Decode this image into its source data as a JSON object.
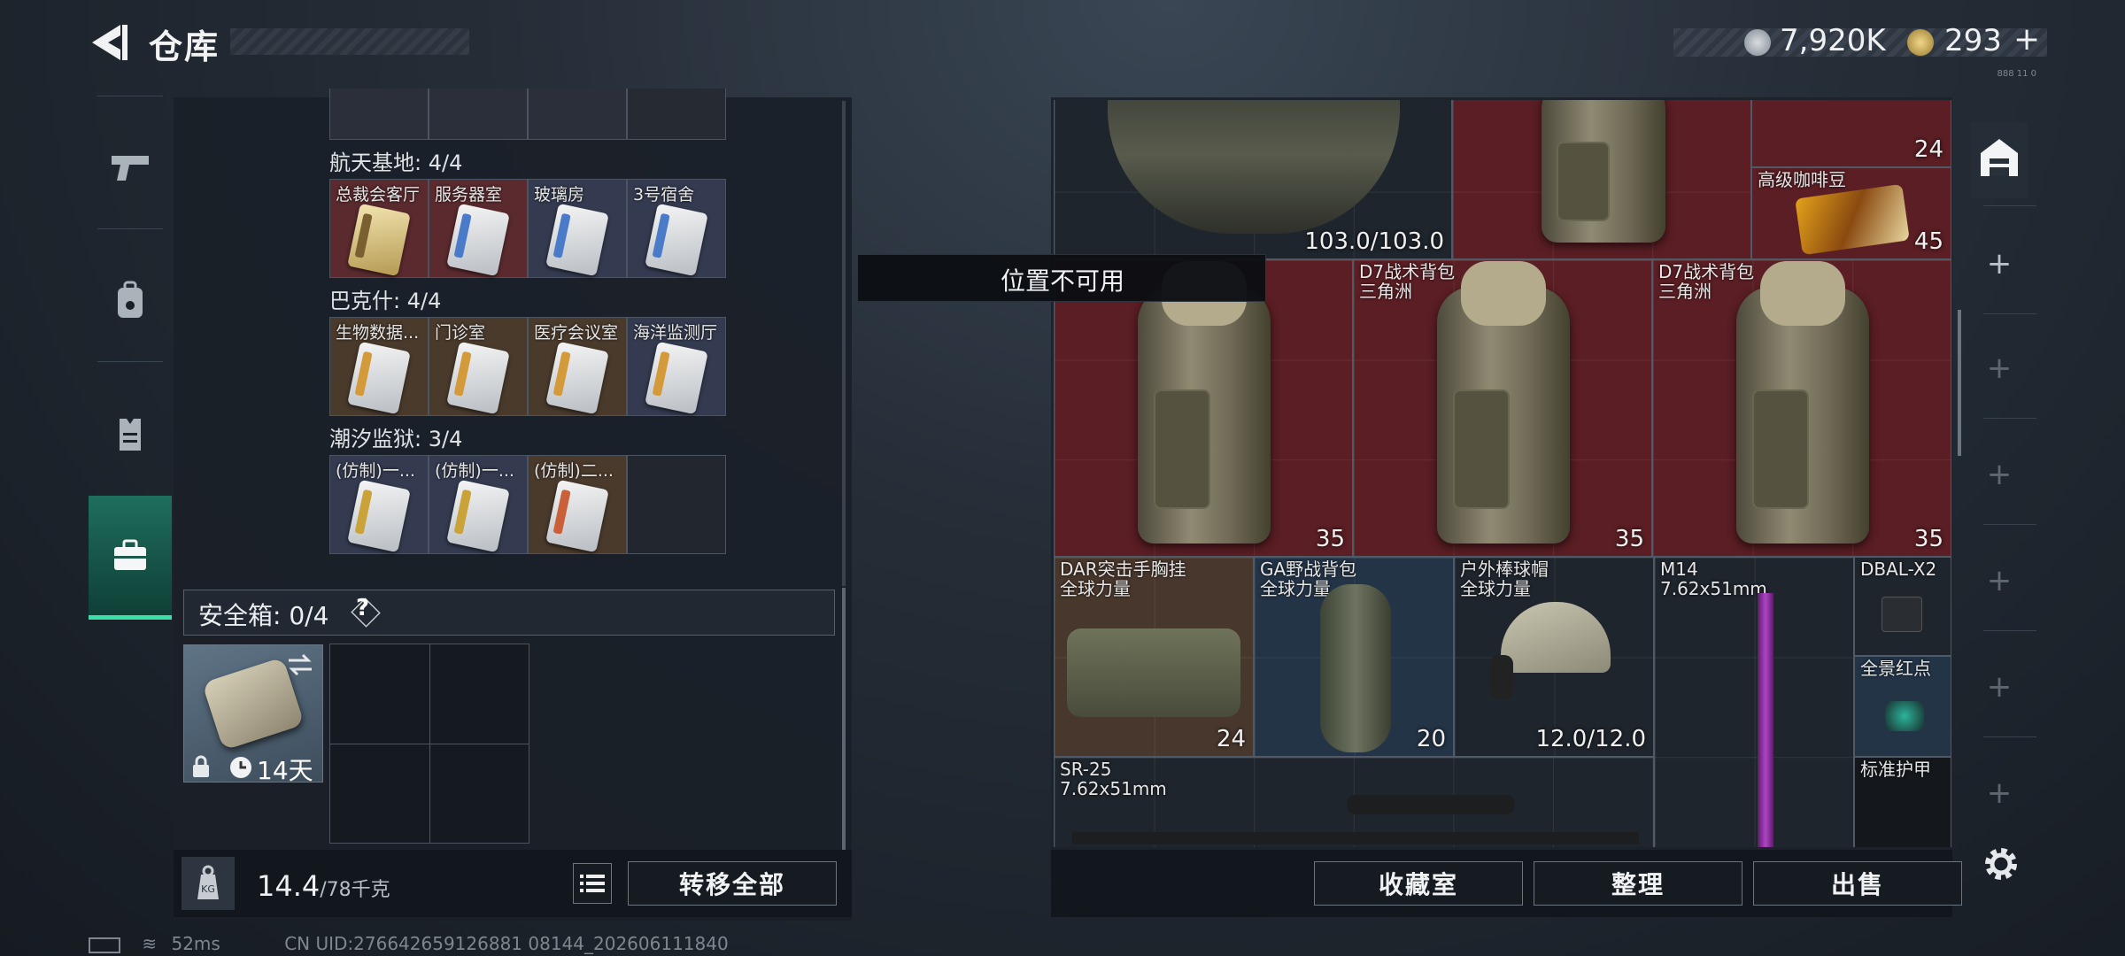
{
  "header": {
    "title": "仓库",
    "currency1": "7,920K",
    "currency2": "293",
    "plus": "+",
    "tiny_text": "888 11 0"
  },
  "left_panel": {
    "sections": [
      {
        "title": "航天基地: 4/4",
        "items": [
          "总裁会客厅",
          "服务器室",
          "玻璃房",
          "3号宿舍"
        ]
      },
      {
        "title": "巴克什: 4/4",
        "items": [
          "生物数据...",
          "门诊室",
          "医疗会议室",
          "海洋监测厅"
        ]
      },
      {
        "title": "潮汐监狱: 3/4",
        "items": [
          "(仿制)一...",
          "(仿制)一...",
          "(仿制)二...",
          ""
        ]
      }
    ],
    "safe_box": {
      "label": "安全箱: 0/4",
      "help": "?",
      "duration": "14天"
    },
    "weight": {
      "current": "14.4",
      "max": "/78千克",
      "weight_icon_text": "KG"
    },
    "transfer_all": "转移全部"
  },
  "right_panel": {
    "items": [
      {
        "name": "",
        "qty": "103.0/103.0"
      },
      {
        "name": "",
        "qty": ""
      },
      {
        "name": "",
        "qty": "24"
      },
      {
        "name": "高级咖啡豆",
        "qty": "45"
      },
      {
        "name": "D7战术背包\n三角洲",
        "qty": "35"
      },
      {
        "name": "D7战术背包\n三角洲",
        "qty": "35"
      },
      {
        "name": "D7战术背包\n三角洲",
        "qty": "35"
      },
      {
        "name": "DAR突击手胸挂\n全球力量",
        "qty": "24"
      },
      {
        "name": "GA野战背包\n全球力量",
        "qty": "20"
      },
      {
        "name": "户外棒球帽\n全球力量",
        "qty": "12.0/12.0"
      },
      {
        "name": "M14\n7.62x51mm",
        "qty": ""
      },
      {
        "name": "DBAL-X2",
        "qty": ""
      },
      {
        "name": "全景红点",
        "qty": ""
      },
      {
        "name": "SR-25\n7.62x51mm",
        "qty": ""
      },
      {
        "name": "标准护甲",
        "qty": ""
      }
    ],
    "tooltip": "位置不可用",
    "buttons": {
      "collection": "收藏室",
      "sort": "整理",
      "sell": "出售"
    }
  },
  "status": {
    "ping": "52ms",
    "uid": "CN UID:276642659126881 08144_202606111840"
  },
  "colors": {
    "accent": "#3be0a6",
    "red_slot": "#601e24",
    "brown_slot": "#4c3a2c",
    "blue_slot": "#24364a"
  }
}
